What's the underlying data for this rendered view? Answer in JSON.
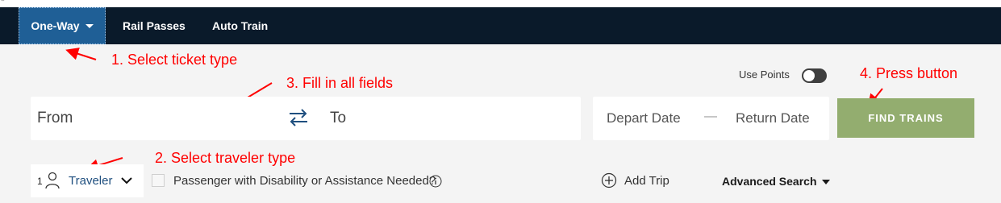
{
  "nav": {
    "tabs": [
      {
        "label": "One-Way"
      },
      {
        "label": "Rail Passes"
      },
      {
        "label": "Auto Train"
      }
    ]
  },
  "annotations": {
    "step1": "1. Select ticket type",
    "step2": "2. Select traveler type",
    "step3": "3. Fill in all fields",
    "step4": "4. Press button",
    "color": "#ff0000"
  },
  "use_points": {
    "label": "Use Points",
    "enabled": false
  },
  "search": {
    "from_placeholder": "From",
    "to_placeholder": "To",
    "depart_placeholder": "Depart Date",
    "date_separator": "—",
    "return_placeholder": "Return Date",
    "find_button": "FIND TRAINS"
  },
  "traveler": {
    "count": "1",
    "label": "Traveler"
  },
  "options": {
    "disability_label": "Passenger with Disability or Assistance Needed?",
    "add_trip": "Add Trip",
    "advanced_search": "Advanced Search"
  },
  "colors": {
    "navbar": "#0a1a2a",
    "active_tab": "#1f5f96",
    "find_button": "#93ad6f",
    "background": "#f4f4f4"
  }
}
